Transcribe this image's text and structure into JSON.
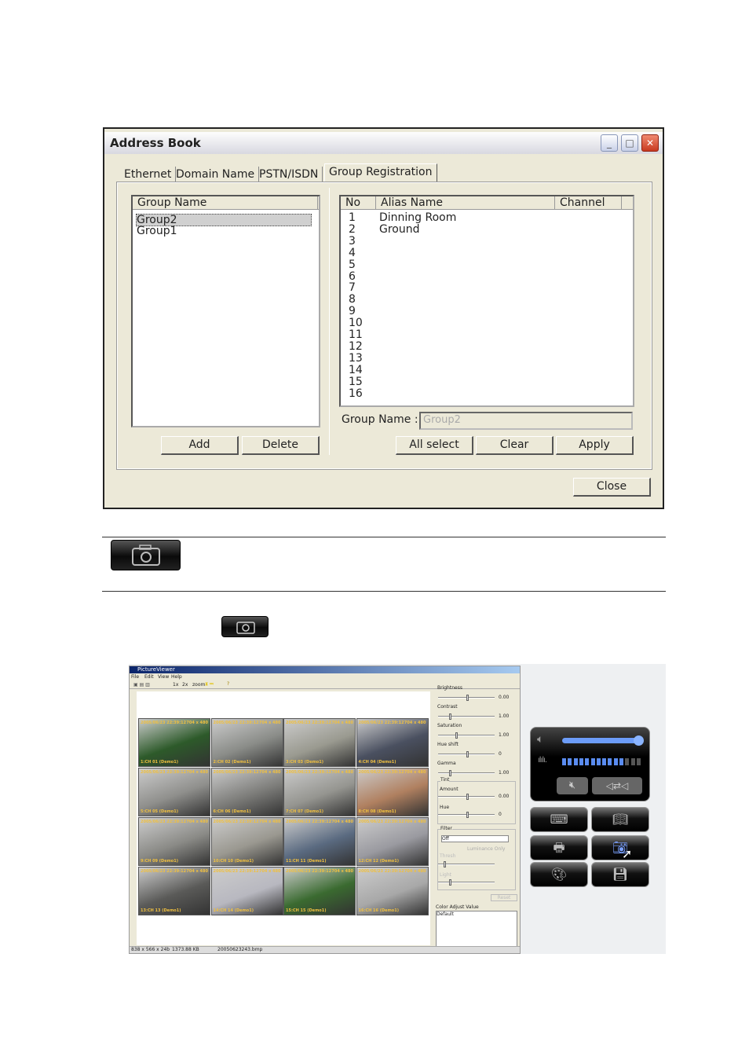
{
  "address_book": {
    "title": "Address Book",
    "tabs": [
      "Ethernet",
      "Domain Name",
      "PSTN/ISDN",
      "Group Registration"
    ],
    "active_tab": "Group Registration",
    "group_list": {
      "header": "Group Name",
      "items": [
        "Group2",
        "Group1"
      ],
      "selected": "Group2"
    },
    "channel_table": {
      "columns": [
        "No",
        "Alias Name",
        "Channel"
      ],
      "rows": [
        {
          "no": "1",
          "alias": "Dinning Room",
          "channel": ""
        },
        {
          "no": "2",
          "alias": "Ground",
          "channel": ""
        },
        {
          "no": "3",
          "alias": "",
          "channel": ""
        },
        {
          "no": "4",
          "alias": "",
          "channel": ""
        },
        {
          "no": "5",
          "alias": "",
          "channel": ""
        },
        {
          "no": "6",
          "alias": "",
          "channel": ""
        },
        {
          "no": "7",
          "alias": "",
          "channel": ""
        },
        {
          "no": "8",
          "alias": "",
          "channel": ""
        },
        {
          "no": "9",
          "alias": "",
          "channel": ""
        },
        {
          "no": "10",
          "alias": "",
          "channel": ""
        },
        {
          "no": "11",
          "alias": "",
          "channel": ""
        },
        {
          "no": "12",
          "alias": "",
          "channel": ""
        },
        {
          "no": "13",
          "alias": "",
          "channel": ""
        },
        {
          "no": "14",
          "alias": "",
          "channel": ""
        },
        {
          "no": "15",
          "alias": "",
          "channel": ""
        },
        {
          "no": "16",
          "alias": "",
          "channel": ""
        }
      ]
    },
    "group_name_label": "Group Name :",
    "group_name_value": "Group2",
    "buttons": {
      "add": "Add",
      "delete": "Delete",
      "all_select": "All select",
      "clear": "Clear",
      "apply": "Apply",
      "close": "Close"
    }
  },
  "icons": {
    "snapshot": "camera-icon"
  },
  "picture_viewer": {
    "title": "PictureViewer",
    "menu": [
      "File",
      "Edit",
      "View",
      "Help"
    ],
    "toolbar_text": [
      "1x",
      "2x",
      "zoom"
    ],
    "cameras": [
      {
        "label": "1:CH 01 (Demo1)",
        "color": "#2d5a2a"
      },
      {
        "label": "2:CH 02 (Demo1)",
        "color": "#8a8c88"
      },
      {
        "label": "3:CH 03 (Demo1)",
        "color": "#9a9a90"
      },
      {
        "label": "4:CH 04 (Demo1)",
        "color": "#4a5060"
      },
      {
        "label": "5:CH 05 (Demo1)",
        "color": "#8f8f8c"
      },
      {
        "label": "6:CH 06 (Demo1)",
        "color": "#7d7d7a"
      },
      {
        "label": "7:CH 07 (Demo1)",
        "color": "#959590"
      },
      {
        "label": "8:CH 08 (Demo1)",
        "color": "#b08060"
      },
      {
        "label": "9:CH 09 (Demo1)",
        "color": "#8a8a86"
      },
      {
        "label": "10:CH 10 (Demo1)",
        "color": "#9a9890"
      },
      {
        "label": "11:CH 11 (Demo1)",
        "color": "#5a6a80"
      },
      {
        "label": "12:CH 12 (Demo1)",
        "color": "#9a9aa0"
      },
      {
        "label": "13:CH 13 (Demo1)",
        "color": "#5a5a58"
      },
      {
        "label": "14:CH 14 (Demo1)",
        "color": "#b8b8c0"
      },
      {
        "label": "15:CH 15 (Demo1)",
        "color": "#3a6a30"
      },
      {
        "label": "16:CH 16 (Demo1)",
        "color": "#a8a8a8"
      }
    ],
    "timestamp": "2005/06/23 22:39:12",
    "resolution": "704 x 480",
    "adjust": [
      {
        "label": "Brightness",
        "value": "0.00"
      },
      {
        "label": "Contrast",
        "value": "1.00"
      },
      {
        "label": "Saturation",
        "value": "1.00"
      },
      {
        "label": "Hue shift",
        "value": "0"
      },
      {
        "label": "Gamma",
        "value": "1.00"
      }
    ],
    "tint": {
      "label": "Tint",
      "amount_label": "Amount",
      "amount": "0.00",
      "hue_label": "Hue",
      "hue": "0"
    },
    "filter": {
      "label": "Filter",
      "value": "Off",
      "checkbox": "Luminance Only",
      "threshold": "Thresh",
      "light": "Light",
      "reset": "Reset"
    },
    "color_adjust_label": "Color Adjust Value",
    "color_adjust_value": "Default",
    "status": [
      "838 x 566 x 24b",
      "1373.88 KB",
      "20050623243.bmp"
    ]
  },
  "remote_panel": {
    "volume_level": 1.0,
    "meter_level": 0.75,
    "accent": "#5a8cf0"
  }
}
